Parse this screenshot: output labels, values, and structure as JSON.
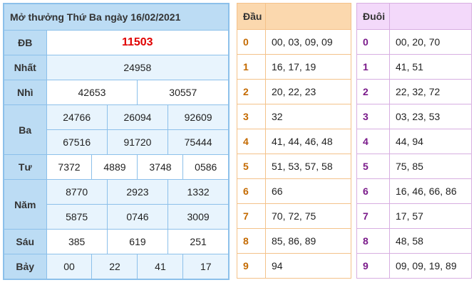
{
  "results": {
    "title": "Mở thưởng Thứ Ba ngày 16/02/2021",
    "db_label": "ĐB",
    "db": "11503",
    "nhat_label": "Nhất",
    "nhat": "24958",
    "nhi_label": "Nhì",
    "nhi": [
      "42653",
      "30557"
    ],
    "ba_label": "Ba",
    "ba": [
      "24766",
      "26094",
      "92609",
      "67516",
      "91720",
      "75444"
    ],
    "tu_label": "Tư",
    "tu": [
      "7372",
      "4889",
      "3748",
      "0586"
    ],
    "nam_label": "Năm",
    "nam": [
      "8770",
      "2923",
      "1332",
      "5875",
      "0746",
      "3009"
    ],
    "sau_label": "Sáu",
    "sau": [
      "385",
      "619",
      "251"
    ],
    "bay_label": "Bảy",
    "bay": [
      "00",
      "22",
      "41",
      "17"
    ]
  },
  "dau": {
    "header": "Đầu",
    "rows": [
      {
        "k": "0",
        "v": "00, 03, 09, 09"
      },
      {
        "k": "1",
        "v": "16, 17, 19"
      },
      {
        "k": "2",
        "v": "20, 22, 23"
      },
      {
        "k": "3",
        "v": "32"
      },
      {
        "k": "4",
        "v": "41, 44, 46, 48"
      },
      {
        "k": "5",
        "v": "51, 53, 57, 58"
      },
      {
        "k": "6",
        "v": "66"
      },
      {
        "k": "7",
        "v": "70, 72, 75"
      },
      {
        "k": "8",
        "v": "85, 86, 89"
      },
      {
        "k": "9",
        "v": "94"
      }
    ]
  },
  "duoi": {
    "header": "Đuôi",
    "rows": [
      {
        "k": "0",
        "v": "00, 20, 70"
      },
      {
        "k": "1",
        "v": "41, 51"
      },
      {
        "k": "2",
        "v": "22, 32, 72"
      },
      {
        "k": "3",
        "v": "03, 23, 53"
      },
      {
        "k": "4",
        "v": "44, 94"
      },
      {
        "k": "5",
        "v": "75, 85"
      },
      {
        "k": "6",
        "v": "16, 46, 66, 86"
      },
      {
        "k": "7",
        "v": "17, 57"
      },
      {
        "k": "8",
        "v": "48, 58"
      },
      {
        "k": "9",
        "v": "09, 09, 19, 89"
      }
    ]
  },
  "colors": {
    "blue_header": "#bcdcf4",
    "blue_border": "#8cc0ea",
    "special_prize": "#e00000",
    "orange_header": "#fbd8ae",
    "purple_header": "#f3d9fa"
  }
}
